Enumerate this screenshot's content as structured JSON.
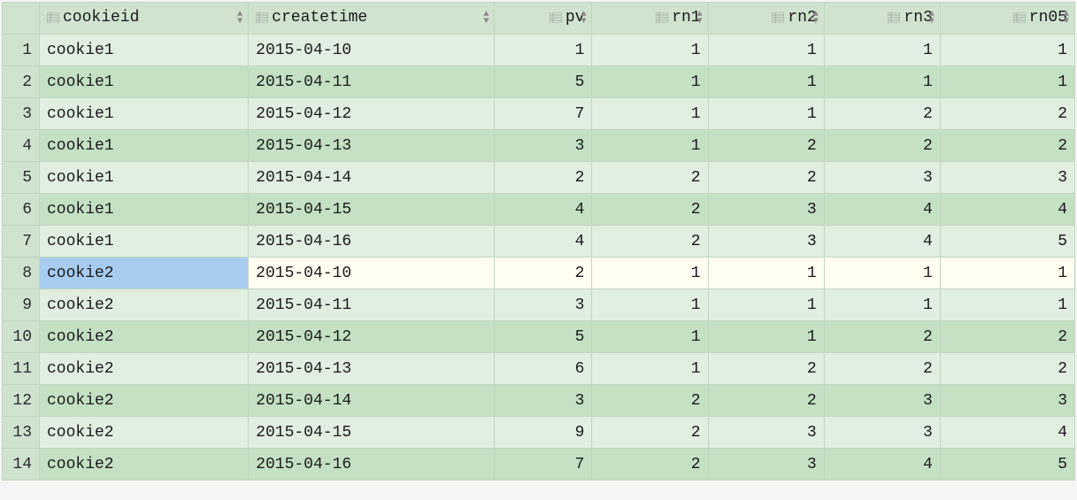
{
  "columns": [
    "cookieid",
    "createtime",
    "pv",
    "rn1",
    "rn2",
    "rn3",
    "rn05"
  ],
  "columnTypes": [
    "text",
    "text",
    "num",
    "num",
    "num",
    "num",
    "num"
  ],
  "highlightedRow": 7,
  "selectedCol": 0,
  "rows": [
    {
      "n": "1",
      "cells": [
        "cookie1",
        "2015-04-10",
        "1",
        "1",
        "1",
        "1",
        "1"
      ]
    },
    {
      "n": "2",
      "cells": [
        "cookie1",
        "2015-04-11",
        "5",
        "1",
        "1",
        "1",
        "1"
      ]
    },
    {
      "n": "3",
      "cells": [
        "cookie1",
        "2015-04-12",
        "7",
        "1",
        "1",
        "2",
        "2"
      ]
    },
    {
      "n": "4",
      "cells": [
        "cookie1",
        "2015-04-13",
        "3",
        "1",
        "2",
        "2",
        "2"
      ]
    },
    {
      "n": "5",
      "cells": [
        "cookie1",
        "2015-04-14",
        "2",
        "2",
        "2",
        "3",
        "3"
      ]
    },
    {
      "n": "6",
      "cells": [
        "cookie1",
        "2015-04-15",
        "4",
        "2",
        "3",
        "4",
        "4"
      ]
    },
    {
      "n": "7",
      "cells": [
        "cookie1",
        "2015-04-16",
        "4",
        "2",
        "3",
        "4",
        "5"
      ]
    },
    {
      "n": "8",
      "cells": [
        "cookie2",
        "2015-04-10",
        "2",
        "1",
        "1",
        "1",
        "1"
      ]
    },
    {
      "n": "9",
      "cells": [
        "cookie2",
        "2015-04-11",
        "3",
        "1",
        "1",
        "1",
        "1"
      ]
    },
    {
      "n": "10",
      "cells": [
        "cookie2",
        "2015-04-12",
        "5",
        "1",
        "1",
        "2",
        "2"
      ]
    },
    {
      "n": "11",
      "cells": [
        "cookie2",
        "2015-04-13",
        "6",
        "1",
        "2",
        "2",
        "2"
      ]
    },
    {
      "n": "12",
      "cells": [
        "cookie2",
        "2015-04-14",
        "3",
        "2",
        "2",
        "3",
        "3"
      ]
    },
    {
      "n": "13",
      "cells": [
        "cookie2",
        "2015-04-15",
        "9",
        "2",
        "3",
        "3",
        "4"
      ]
    },
    {
      "n": "14",
      "cells": [
        "cookie2",
        "2015-04-16",
        "7",
        "2",
        "3",
        "4",
        "5"
      ]
    }
  ]
}
